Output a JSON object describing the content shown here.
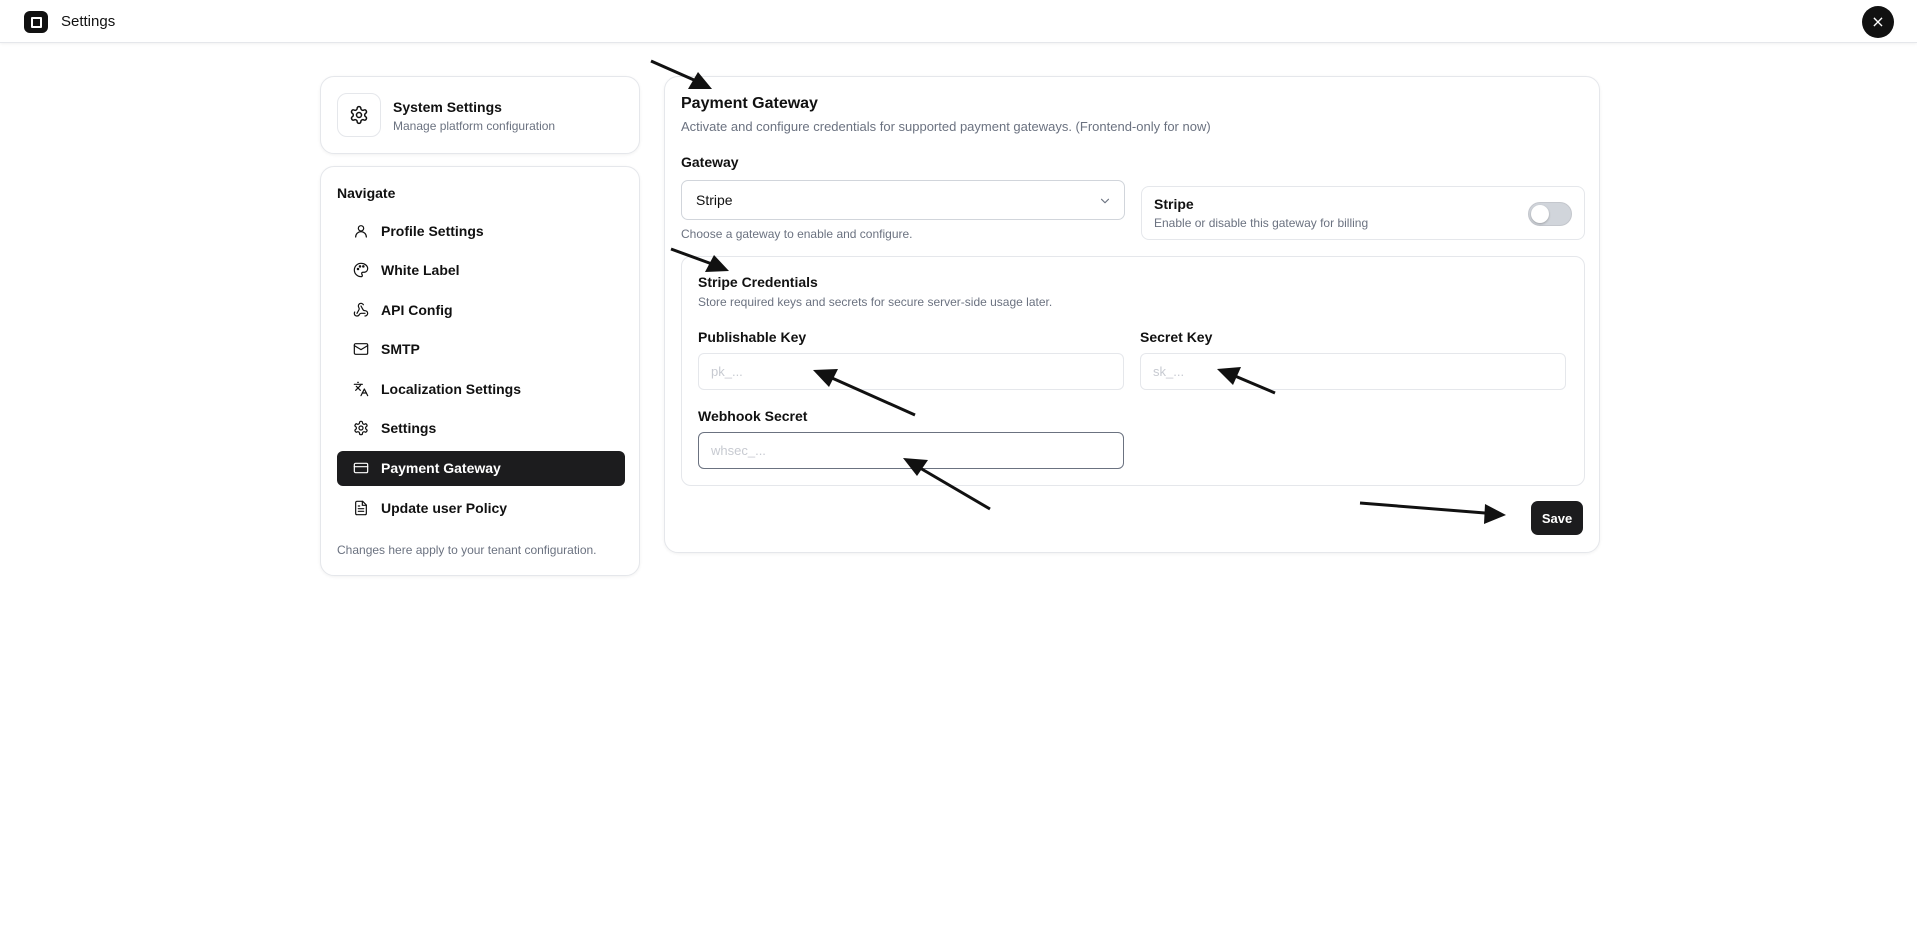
{
  "topbar": {
    "title": "Settings",
    "close_label": "×"
  },
  "header_card": {
    "title": "System Settings",
    "subtitle": "Manage platform configuration",
    "icon": "gear-icon"
  },
  "nav": {
    "heading": "Navigate",
    "items": [
      {
        "label": "Profile Settings",
        "icon": "user-icon",
        "active": false
      },
      {
        "label": "White Label",
        "icon": "palette-icon",
        "active": false
      },
      {
        "label": "API Config",
        "icon": "webhook-icon",
        "active": false
      },
      {
        "label": "SMTP",
        "icon": "mail-icon",
        "active": false
      },
      {
        "label": "Localization Settings",
        "icon": "languages-icon",
        "active": false
      },
      {
        "label": "Settings",
        "icon": "gear-icon",
        "active": false
      },
      {
        "label": "Payment Gateway",
        "icon": "credit-card-icon",
        "active": true
      },
      {
        "label": "Update user Policy",
        "icon": "document-icon",
        "active": false
      }
    ],
    "footer": "Changes here apply to your tenant configuration."
  },
  "main": {
    "title": "Payment Gateway",
    "subtitle": "Activate and configure credentials for supported payment gateways. (Frontend-only for now)",
    "gateway_label": "Gateway",
    "gateway_value": "Stripe",
    "gateway_helper": "Choose a gateway to enable and configure.",
    "toggle": {
      "title": "Stripe",
      "subtitle": "Enable or disable this gateway for billing",
      "enabled": false
    },
    "credentials": {
      "title": "Stripe Credentials",
      "subtitle": "Store required keys and secrets for secure server-side usage later.",
      "publishable_key": {
        "label": "Publishable Key",
        "value": "",
        "placeholder": "pk_..."
      },
      "secret_key": {
        "label": "Secret Key",
        "value": "",
        "placeholder": "sk_..."
      },
      "webhook_secret": {
        "label": "Webhook Secret",
        "value": "",
        "placeholder": "whsec_..."
      }
    },
    "save_label": "Save"
  },
  "colors": {
    "primary": "#1c1c1e",
    "muted_text": "#6b7280",
    "border": "#e5e7eb",
    "toggle_off": "#d1d5db"
  }
}
